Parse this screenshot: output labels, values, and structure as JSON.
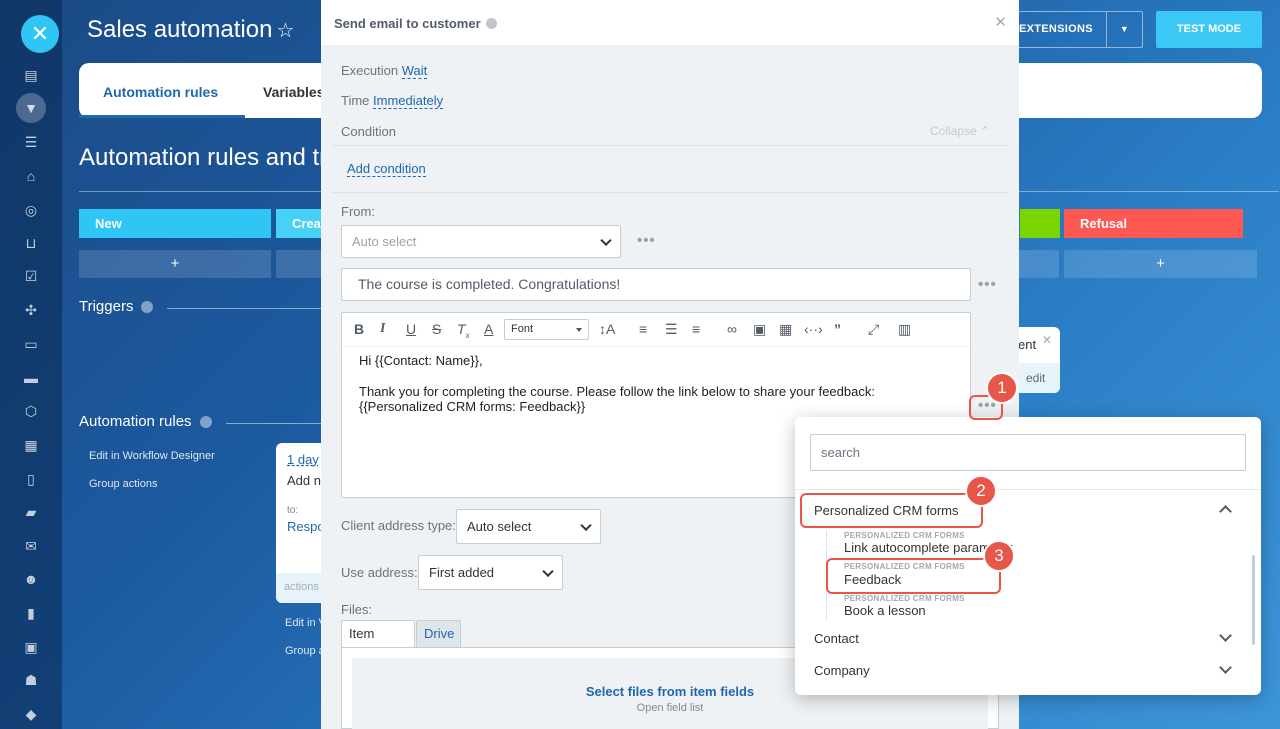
{
  "page": {
    "title": "Sales automation",
    "extensions_label": "EXTENSIONS",
    "test_mode_label": "TEST MODE",
    "tabs": [
      "Automation rules",
      "Variables"
    ],
    "heading": "Automation rules and tri",
    "stages": [
      "New",
      "Crea",
      "Refusal"
    ],
    "triggers_label": "Triggers",
    "automation_rules_label": "Automation rules",
    "side_links": [
      "Edit in Workflow Designer",
      "Group actions",
      "Edit in V",
      "Group a"
    ],
    "card": {
      "delay": "1 day",
      "name": "Add n",
      "to": "to:",
      "resp": "Respo",
      "actions": "actions"
    },
    "trigger_card": {
      "label": "ent",
      "edit": "edit"
    }
  },
  "modal": {
    "title": "Send email to customer",
    "execution_label": "Execution",
    "execution_value": "Wait",
    "time_label": "Time",
    "time_value": "Immediately",
    "condition_label": "Condition",
    "collapse_label": "Collapse",
    "add_condition": "Add condition",
    "from_label": "From:",
    "from_placeholder": "Auto select",
    "subject": "The course is completed. Congratulations!",
    "font_select": "Font",
    "body_line1": "Hi {{Contact: Name}},",
    "body_line2": "Thank you for completing the course. Please follow the link below to share your feedback:",
    "body_line3": "{{Personalized CRM forms: Feedback}}",
    "client_address_label": "Client address type:",
    "client_address_value": "Auto select",
    "use_address_label": "Use address:",
    "use_address_value": "First added",
    "files_label": "Files:",
    "files_tabs": [
      "Item fields",
      "Drive"
    ],
    "files_title": "Select files from item fields",
    "files_sub": "Open field list"
  },
  "popup": {
    "search_placeholder": "search",
    "groups": [
      "Personalized CRM forms",
      "Contact",
      "Company"
    ],
    "items": [
      {
        "caption": "PERSONALIZED CRM FORMS",
        "name": "Link autocomplete parameter"
      },
      {
        "caption": "PERSONALIZED CRM FORMS",
        "name": "Feedback"
      },
      {
        "caption": "PERSONALIZED CRM FORMS",
        "name": "Book a lesson"
      }
    ]
  },
  "annotations": [
    "1",
    "2",
    "3"
  ],
  "colors": {
    "accent": "#2067b0",
    "highlight": "#e8564a",
    "refusal": "#ff5752",
    "new_stage": "#2fc6f6"
  }
}
